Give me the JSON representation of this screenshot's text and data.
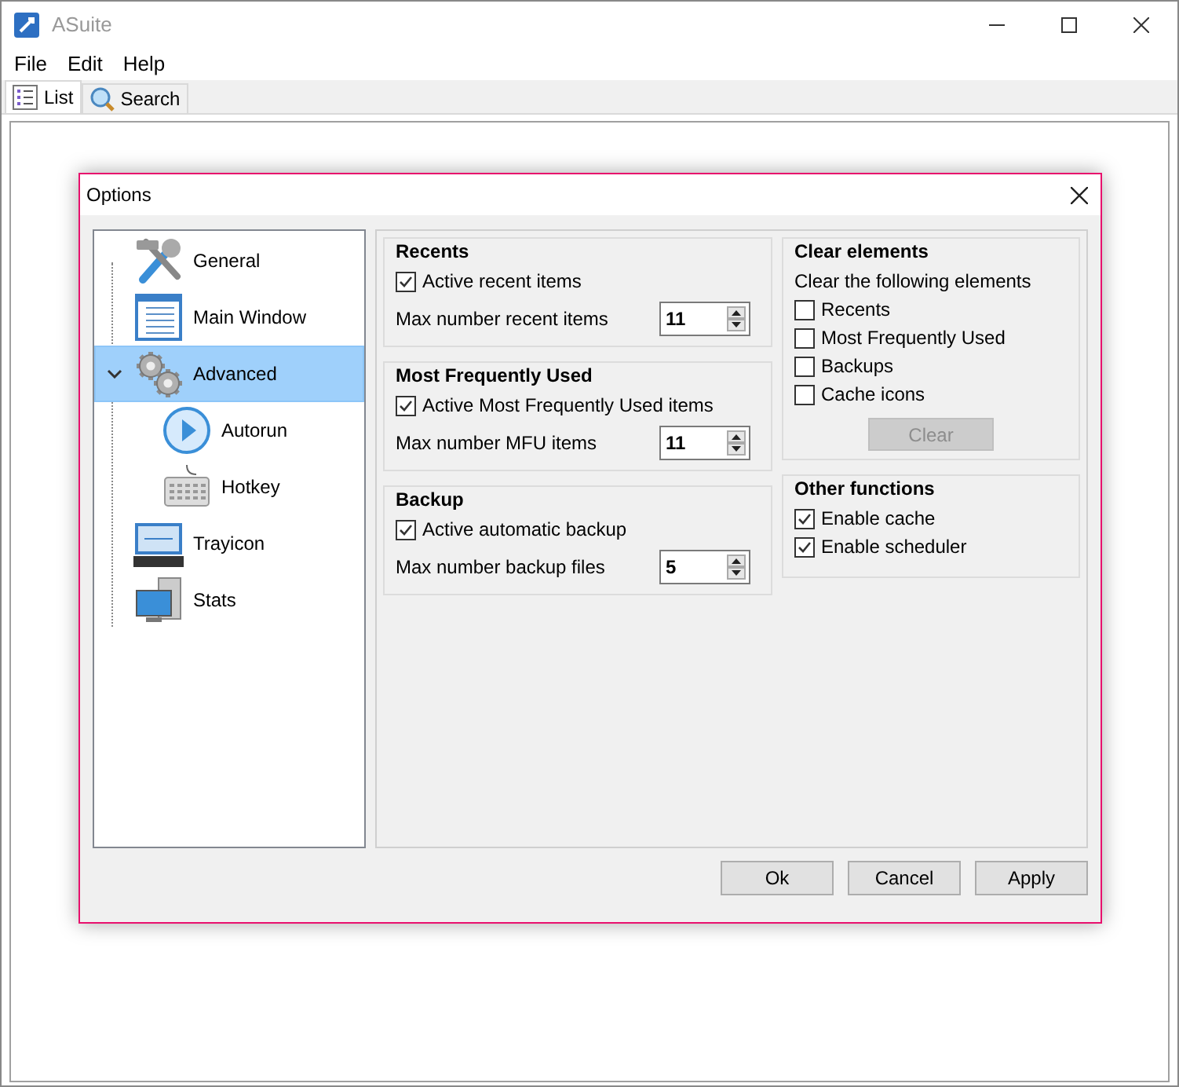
{
  "window": {
    "title": "ASuite"
  },
  "menu": [
    "File",
    "Edit",
    "Help"
  ],
  "tabs": [
    {
      "label": "List",
      "selected": true
    },
    {
      "label": "Search",
      "selected": false
    }
  ],
  "dialog": {
    "title": "Options",
    "tree": [
      {
        "label": "General",
        "selected": false
      },
      {
        "label": "Main Window",
        "selected": false
      },
      {
        "label": "Advanced",
        "selected": true,
        "expanded": true,
        "children": [
          {
            "label": "Autorun",
            "selected": false
          },
          {
            "label": "Hotkey",
            "selected": false
          }
        ]
      },
      {
        "label": "Trayicon",
        "selected": false
      },
      {
        "label": "Stats",
        "selected": false
      }
    ],
    "columns": [
      [
        {
          "title": "Recents",
          "items": [
            {
              "kind": "checkbox",
              "label": "Active recent items",
              "checked": true
            },
            {
              "kind": "spin",
              "label": "Max number recent items",
              "value": "11"
            }
          ]
        },
        {
          "title": "Most Frequently Used",
          "items": [
            {
              "kind": "checkbox",
              "label": "Active Most Frequently Used items",
              "checked": true
            },
            {
              "kind": "spin",
              "label": "Max number MFU items",
              "value": "11"
            }
          ]
        },
        {
          "title": "Backup",
          "items": [
            {
              "kind": "checkbox",
              "label": "Active automatic backup",
              "checked": true
            },
            {
              "kind": "spin",
              "label": "Max number backup files",
              "value": "5"
            }
          ]
        }
      ],
      [
        {
          "title": "Clear elements",
          "items": [
            {
              "kind": "text",
              "label": "Clear the following elements"
            },
            {
              "kind": "checkbox",
              "label": "Recents",
              "checked": false
            },
            {
              "kind": "checkbox",
              "label": "Most Frequently Used",
              "checked": false
            },
            {
              "kind": "checkbox",
              "label": "Backups",
              "checked": false
            },
            {
              "kind": "checkbox",
              "label": "Cache icons",
              "checked": false
            },
            {
              "kind": "button",
              "label": "Clear",
              "disabled": true
            }
          ]
        },
        {
          "title": "Other functions",
          "items": [
            {
              "kind": "checkbox",
              "label": "Enable cache",
              "checked": true
            },
            {
              "kind": "checkbox",
              "label": "Enable scheduler",
              "checked": true
            }
          ]
        }
      ]
    ],
    "buttons": [
      "Ok",
      "Cancel",
      "Apply"
    ]
  }
}
